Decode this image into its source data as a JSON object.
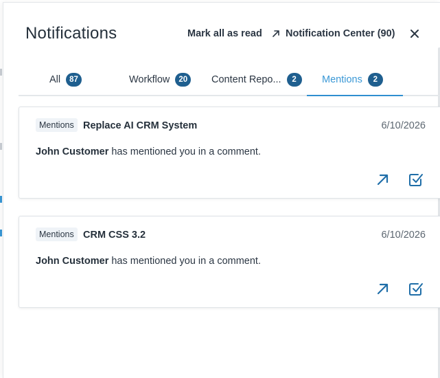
{
  "panel": {
    "title": "Notifications",
    "mark_all_read_label": "Mark all as read",
    "notification_center_label": "Notification Center (90)"
  },
  "tabs": [
    {
      "label": "All",
      "count": "87",
      "active": false
    },
    {
      "label": "Workflow",
      "count": "20",
      "active": false
    },
    {
      "label": "Content Repo...",
      "count": "2",
      "active": false
    },
    {
      "label": "Mentions",
      "count": "2",
      "active": true
    }
  ],
  "notifications": [
    {
      "type": "Mentions",
      "title": "Replace AI CRM System",
      "date": "6/10/2026",
      "actor": "John Customer",
      "message": " has mentioned you in a comment."
    },
    {
      "type": "Mentions",
      "title": "CRM CSS 3.2",
      "date": "6/10/2026",
      "actor": "John Customer",
      "message": " has mentioned you in a comment."
    }
  ],
  "icons": {
    "external_link": "external-link-icon",
    "close": "close-icon",
    "open": "open-arrow-icon",
    "mark_read": "check-square-icon"
  },
  "colors": {
    "accent": "#3a98d6",
    "badge": "#1f5f8f",
    "action_icon": "#1f6ea8",
    "text": "#25303b"
  }
}
